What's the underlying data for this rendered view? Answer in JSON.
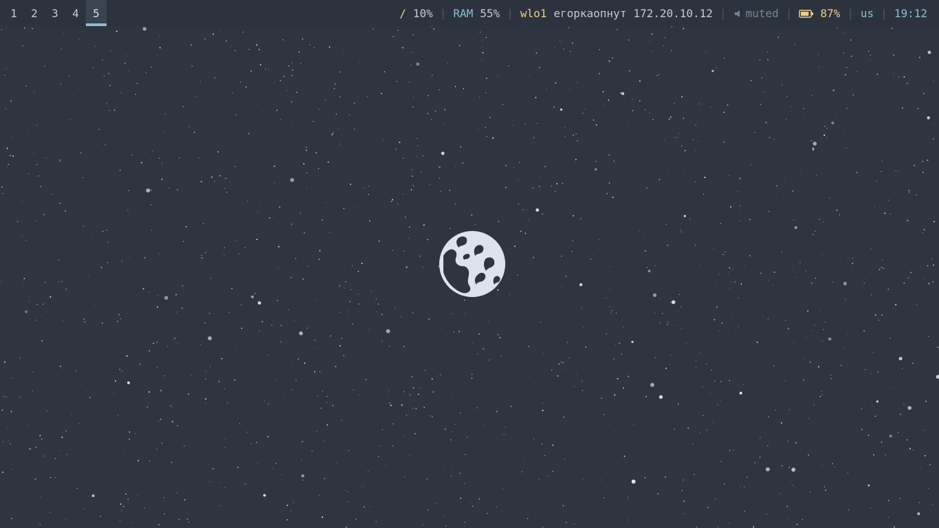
{
  "workspaces": [
    {
      "label": "1",
      "active": false
    },
    {
      "label": "2",
      "active": false
    },
    {
      "label": "3",
      "active": false
    },
    {
      "label": "4",
      "active": false
    },
    {
      "label": "5",
      "active": true
    }
  ],
  "status": {
    "disk": {
      "label": "/",
      "value": "10%"
    },
    "ram": {
      "label": "RAM",
      "value": "55%"
    },
    "network": {
      "interface": "wlo1",
      "ssid": "егоркаопнут",
      "ip": "172.20.10.12"
    },
    "volume": {
      "icon": "speaker-icon",
      "text": "muted"
    },
    "battery": {
      "icon": "battery-icon",
      "value": "87%",
      "level": 0.87
    },
    "keyboard_layout": "us",
    "clock": "19:12"
  },
  "wallpaper": {
    "subject": "earth-in-starfield-icon"
  },
  "colors": {
    "background": "#2e3440",
    "bar_background": "#2d333e",
    "accent_yellow": "#ebcb8b",
    "accent_cyan": "#88c0d0",
    "separator": "#4c566a",
    "text": "#c5cad3",
    "muted_text": "#7b8394"
  }
}
